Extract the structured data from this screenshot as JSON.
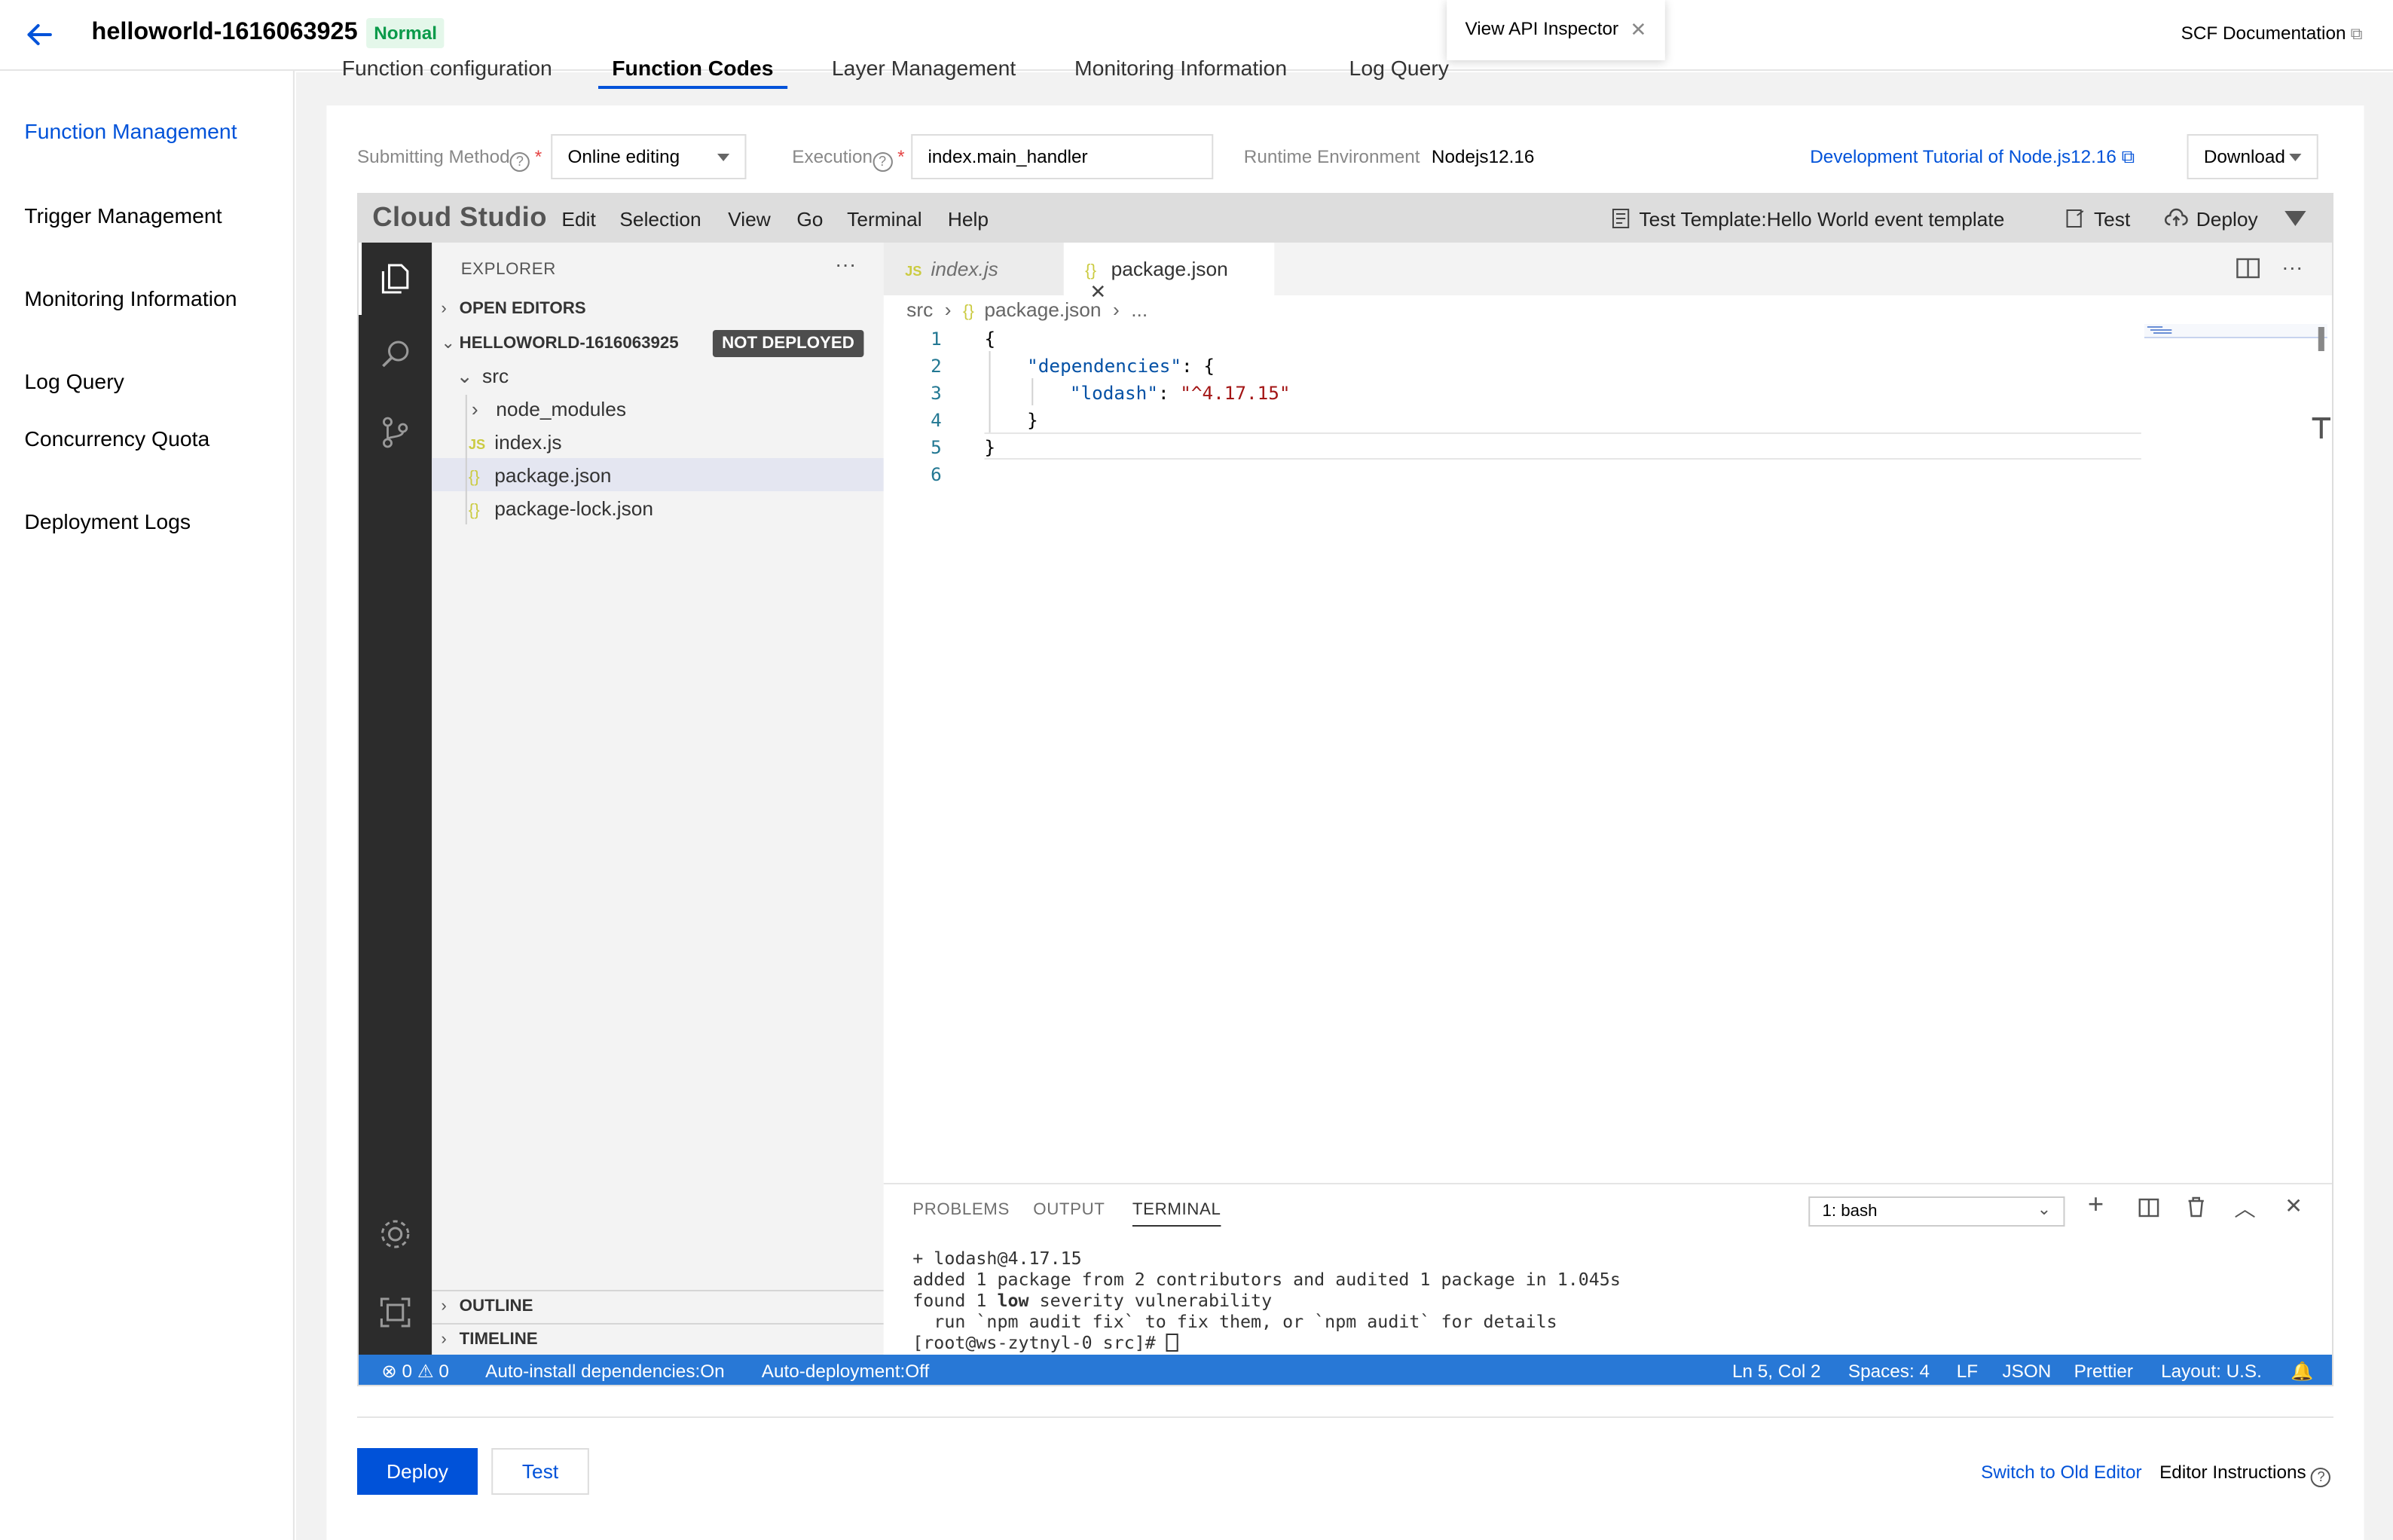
{
  "header": {
    "function_name": "helloworld-1616063925",
    "status": "Normal",
    "api_inspector": "View API Inspector",
    "scf_documentation": "SCF Documentation"
  },
  "leftnav": {
    "items": [
      {
        "label": "Function Management",
        "active": true
      },
      {
        "label": "Trigger Management",
        "active": false
      },
      {
        "label": "Monitoring Information",
        "active": false
      },
      {
        "label": "Log Query",
        "active": false
      },
      {
        "label": "Concurrency Quota",
        "active": false
      },
      {
        "label": "Deployment Logs",
        "active": false
      }
    ]
  },
  "top_tabs": [
    "Function configuration",
    "Function Codes",
    "Layer Management",
    "Monitoring Information",
    "Log Query"
  ],
  "form": {
    "submitting_method_label": "Submitting Method",
    "submitting_method_value": "Online editing",
    "execution_label": "Execution",
    "execution_value": "index.main_handler",
    "runtime_label": "Runtime Environment",
    "runtime_value": "Nodejs12.16",
    "dev_tutorial_link": "Development Tutorial of Node.js12.16",
    "download_label": "Download"
  },
  "ide": {
    "logo": "Cloud Studio",
    "menu": [
      "Edit",
      "Selection",
      "View",
      "Go",
      "Terminal",
      "Help"
    ],
    "test_template": "Test Template:Hello World event template",
    "test_label": "Test",
    "deploy_label": "Deploy",
    "explorer": {
      "title": "EXPLORER",
      "open_editors": "OPEN EDITORS",
      "project": "HELLOWORLD-1616063925",
      "not_deployed": "NOT DEPLOYED",
      "tree": [
        "src",
        "node_modules",
        "index.js",
        "package.json",
        "package-lock.json"
      ],
      "outline": "OUTLINE",
      "timeline": "TIMELINE"
    },
    "tabs": [
      {
        "label": "index.js",
        "active": false
      },
      {
        "label": "package.json",
        "active": true
      }
    ],
    "breadcrumbs": {
      "folder": "src",
      "file": "package.json",
      "more": "..."
    },
    "code": {
      "line_numbers": [
        "1",
        "2",
        "3",
        "4",
        "5",
        "6"
      ],
      "l1": "{",
      "l2_key": "\"dependencies\"",
      "l2_rest": ": {",
      "l3_key": "\"lodash\"",
      "l3_colon": ": ",
      "l3_val": "\"^4.17.15\"",
      "l4": "}",
      "l5": "}"
    },
    "panel": {
      "tabs": [
        "PROBLEMS",
        "OUTPUT",
        "TERMINAL"
      ],
      "shell": "1: bash",
      "terminal": {
        "line1": "+ lodash@4.17.15",
        "line2": "added 1 package from 2 contributors and audited 1 package in 1.045s",
        "line3_a": "found 1 ",
        "line3_b": "low",
        "line3_c": " severity vulnerability",
        "line4": "  run `npm audit fix` to fix them, or `npm audit` for details",
        "line5": "[root@ws-zytnyl-0 src]# "
      }
    },
    "statusbar": {
      "errors": "0",
      "warnings": "0",
      "auto_install": "Auto-install dependencies:On",
      "auto_deploy": "Auto-deployment:Off",
      "position": "Ln 5, Col 2",
      "spaces": "Spaces: 4",
      "eol": "LF",
      "language": "JSON",
      "formatter": "Prettier",
      "layout": "Layout: U.S."
    }
  },
  "footer": {
    "deploy": "Deploy",
    "test": "Test",
    "switch_old": "Switch to Old Editor",
    "instructions": "Editor Instructions"
  },
  "colors": {
    "brand_blue": "#0052d9",
    "statusbar_blue": "#2878d6",
    "status_green": "#0a9a4a"
  }
}
